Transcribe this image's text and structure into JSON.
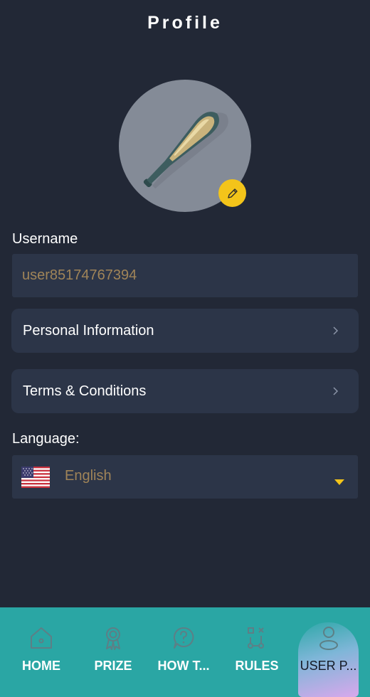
{
  "header": {
    "title": "Profile"
  },
  "avatar": {
    "image": "baseball-bat",
    "edit_icon": "pencil-icon"
  },
  "username": {
    "label": "Username",
    "value": "user85174767394"
  },
  "menu": {
    "items": [
      {
        "label": "Personal Information",
        "icon": "chevron-right-icon"
      },
      {
        "label": "Terms & Conditions",
        "icon": "chevron-right-icon"
      }
    ]
  },
  "language": {
    "label": "Language:",
    "selected": "English",
    "flag": "us-flag-icon"
  },
  "nav": {
    "items": [
      {
        "label": "HOME",
        "icon": "home-icon"
      },
      {
        "label": "PRIZE",
        "icon": "award-icon"
      },
      {
        "label": "HOW T...",
        "icon": "question-icon"
      },
      {
        "label": "RULES",
        "icon": "rules-icon"
      },
      {
        "label": "USER P...",
        "icon": "user-icon",
        "active": true
      }
    ]
  },
  "colors": {
    "background": "#222836",
    "card": "#2c3548",
    "accent": "#f3c41a",
    "value_text": "#a08458",
    "nav_bar": "#2aa6a4"
  }
}
